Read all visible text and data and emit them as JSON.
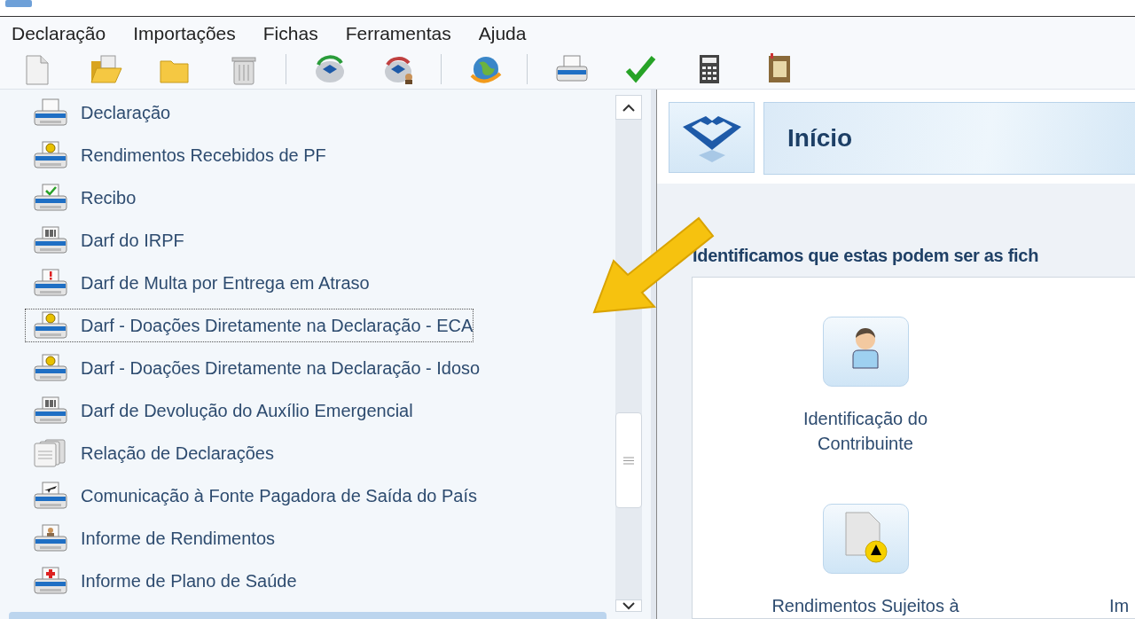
{
  "menu": [
    {
      "label": "Declaração"
    },
    {
      "label": "Importações"
    },
    {
      "label": "Fichas"
    },
    {
      "label": "Ferramentas"
    },
    {
      "label": "Ajuda"
    }
  ],
  "sidebar": {
    "items": [
      {
        "label": "Declaração",
        "kind": "plain",
        "selected": false
      },
      {
        "label": "Rendimentos Recebidos de PF",
        "kind": "coin",
        "selected": false
      },
      {
        "label": "Recibo",
        "kind": "check",
        "selected": false
      },
      {
        "label": "Darf do IRPF",
        "kind": "barcode",
        "selected": false
      },
      {
        "label": "Darf de Multa por Entrega em Atraso",
        "kind": "alert",
        "selected": false
      },
      {
        "label": "Darf - Doações Diretamente na Declaração - ECA",
        "kind": "coin",
        "selected": true
      },
      {
        "label": "Darf - Doações Diretamente na Declaração - Idoso",
        "kind": "coin",
        "selected": false
      },
      {
        "label": "Darf de Devolução do Auxílio Emergencial",
        "kind": "barcode",
        "selected": false
      },
      {
        "label": "Relação de Declarações",
        "kind": "documents",
        "selected": false
      },
      {
        "label": "Comunicação à Fonte Pagadora de Saída do País",
        "kind": "plane",
        "selected": false
      },
      {
        "label": "Informe de Rendimentos",
        "kind": "person",
        "selected": false
      },
      {
        "label": "Informe de Plano de Saúde",
        "kind": "cross",
        "selected": false
      }
    ]
  },
  "home": {
    "title": "Início",
    "heading": "Identificamos que estas podem ser as fich",
    "cards": [
      {
        "label": "Identificação do Contribuinte",
        "kind": "person"
      },
      {
        "label": "Rendimentos Sujeitos à",
        "kind": "warning"
      }
    ],
    "cut_label": "Im"
  }
}
